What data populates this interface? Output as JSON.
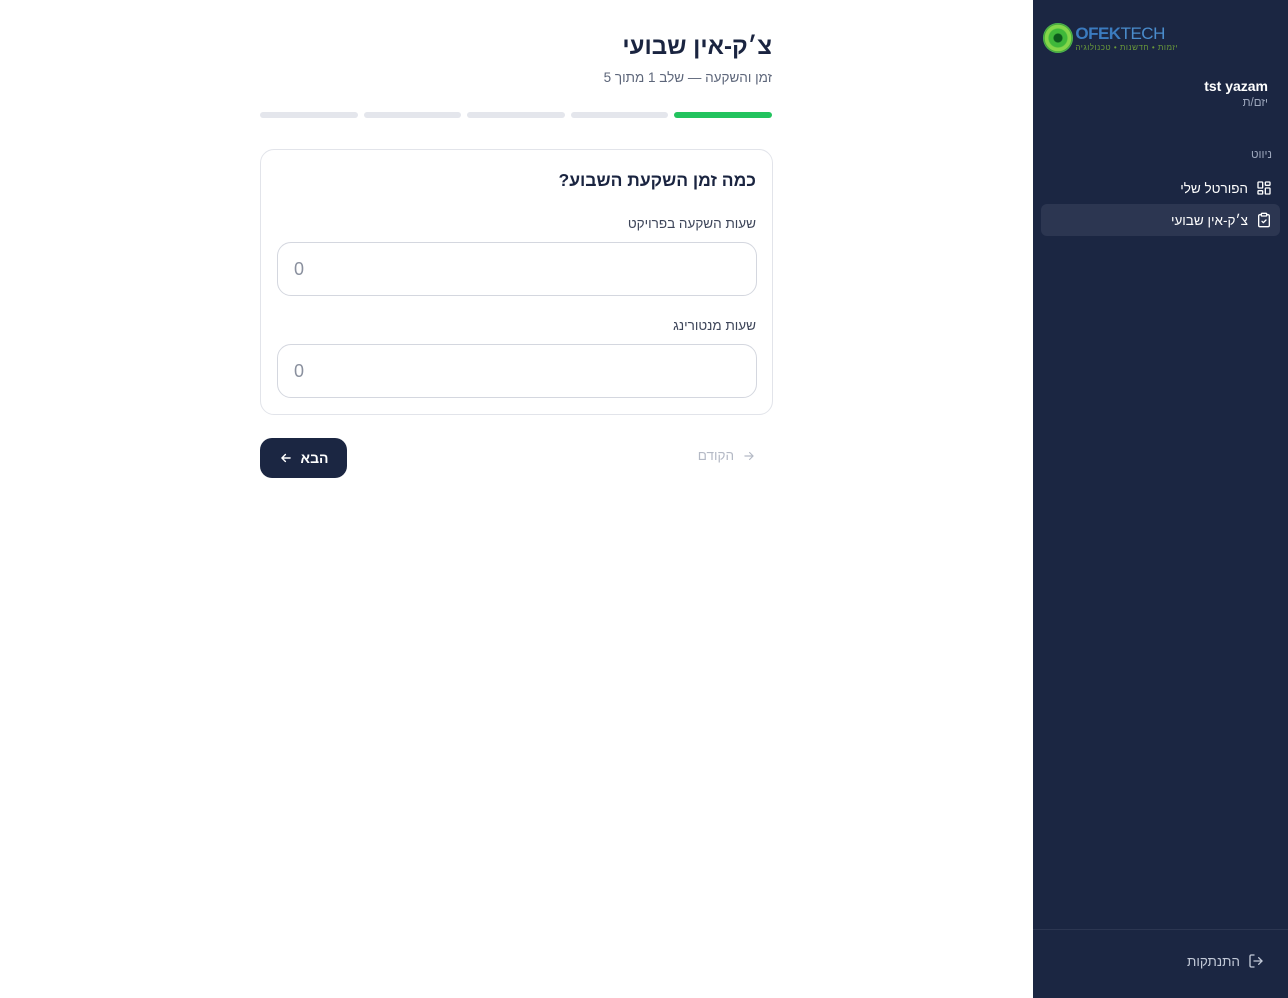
{
  "sidebar": {
    "logo": {
      "word_main": "OFEK",
      "word_accent": "TECH",
      "tagline": "יזמות • חדשנות • טכנולוגיה"
    },
    "user": {
      "name": "tst yazam",
      "role": "יזם/ת"
    },
    "nav_heading": "ניווט",
    "items": [
      {
        "label": "הפורטל שלי",
        "icon": "grid-icon",
        "active": false
      },
      {
        "label": "צ׳ק-אין שבועי",
        "icon": "clipboard-check-icon",
        "active": true
      }
    ],
    "logout_label": "התנתקות"
  },
  "main": {
    "title": "צ׳ק-אין שבועי",
    "subtitle": "זמן והשקעה — שלב 1 מתוך 5",
    "progress": {
      "current_step": 1,
      "total_steps": 5
    },
    "card": {
      "question": "כמה זמן השקעת השבוע?",
      "fields": [
        {
          "label": "שעות השקעה בפרויקט",
          "placeholder": "0",
          "value": ""
        },
        {
          "label": "שעות מנטורינג",
          "placeholder": "0",
          "value": ""
        }
      ]
    },
    "next_label": "הבא",
    "prev_label": "הקודם"
  },
  "colors": {
    "sidebar_bg": "#1b2642",
    "progress_active": "#22c35e",
    "progress_inactive": "#e4e6ec",
    "primary_button": "#1b2642"
  }
}
